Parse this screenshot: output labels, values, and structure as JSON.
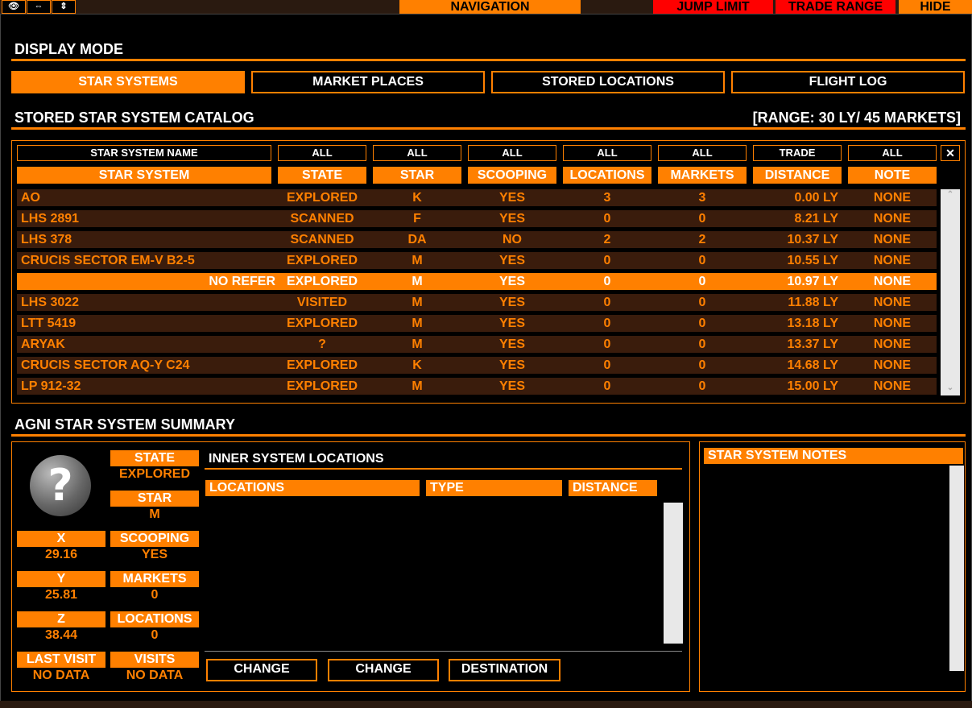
{
  "topbar": {
    "icons": [
      "eye-icon",
      "horizontal-arrows-icon",
      "vertical-arrows-icon"
    ],
    "icon_glyphs": [
      "👁",
      "⇔",
      "⇕"
    ],
    "navigation": "NAVIGATION",
    "jump_limit": "JUMP LIMIT",
    "trade_range": "TRADE RANGE",
    "hide": "HIDE"
  },
  "display_mode": {
    "title": "DISPLAY MODE",
    "buttons": [
      "STAR SYSTEMS",
      "MARKET PLACES",
      "STORED LOCATIONS",
      "FLIGHT LOG"
    ],
    "active": "STAR SYSTEMS"
  },
  "catalog": {
    "title": "STORED STAR SYSTEM CATALOG",
    "range": "[RANGE: 30 LY/ 45 MARKETS]",
    "filters": [
      "STAR SYSTEM NAME",
      "ALL",
      "ALL",
      "ALL",
      "ALL",
      "ALL",
      "TRADE",
      "ALL"
    ],
    "clear": "✕",
    "columns": [
      "STAR SYSTEM",
      "STATE",
      "STAR",
      "SCOOPING",
      "LOCATIONS",
      "MARKETS",
      "DISTANCE",
      "NOTE"
    ],
    "rows": [
      {
        "name": "AO",
        "state": "EXPLORED",
        "star": "K",
        "scooping": "YES",
        "locations": "3",
        "markets": "3",
        "distance": "0.00 LY",
        "note": "NONE"
      },
      {
        "name": "LHS 2891",
        "state": "SCANNED",
        "star": "F",
        "scooping": "YES",
        "locations": "0",
        "markets": "0",
        "distance": "8.21 LY",
        "note": "NONE"
      },
      {
        "name": "LHS 378",
        "state": "SCANNED",
        "star": "DA",
        "scooping": "NO",
        "locations": "2",
        "markets": "2",
        "distance": "10.37 LY",
        "note": "NONE"
      },
      {
        "name": "CRUCIS SECTOR EM-V B2-5",
        "state": "EXPLORED",
        "star": "M",
        "scooping": "YES",
        "locations": "0",
        "markets": "0",
        "distance": "10.55 LY",
        "note": "NONE"
      },
      {
        "name": "NO REFER",
        "state": "EXPLORED",
        "star": "M",
        "scooping": "YES",
        "locations": "0",
        "markets": "0",
        "distance": "10.97 LY",
        "note": "NONE",
        "selected": true
      },
      {
        "name": "LHS 3022",
        "state": "VISITED",
        "star": "M",
        "scooping": "YES",
        "locations": "0",
        "markets": "0",
        "distance": "11.88 LY",
        "note": "NONE"
      },
      {
        "name": "LTT 5419",
        "state": "EXPLORED",
        "star": "M",
        "scooping": "YES",
        "locations": "0",
        "markets": "0",
        "distance": "13.18 LY",
        "note": "NONE"
      },
      {
        "name": "ARYAK",
        "state": "?",
        "star": "M",
        "scooping": "YES",
        "locations": "0",
        "markets": "0",
        "distance": "13.37 LY",
        "note": "NONE"
      },
      {
        "name": "CRUCIS SECTOR AQ-Y C24",
        "state": "EXPLORED",
        "star": "K",
        "scooping": "YES",
        "locations": "0",
        "markets": "0",
        "distance": "14.68 LY",
        "note": "NONE"
      },
      {
        "name": "LP 912-32",
        "state": "EXPLORED",
        "star": "M",
        "scooping": "YES",
        "locations": "0",
        "markets": "0",
        "distance": "15.00 LY",
        "note": "NONE"
      }
    ]
  },
  "summary": {
    "title": "AGNI STAR SYSTEM SUMMARY",
    "state_label": "STATE",
    "state": "EXPLORED",
    "star_label": "STAR",
    "star": "M",
    "x_label": "X",
    "x": "29.16",
    "scooping_label": "SCOOPING",
    "scooping": "YES",
    "y_label": "Y",
    "y": "25.81",
    "markets_label": "MARKETS",
    "markets": "0",
    "z_label": "Z",
    "z": "38.44",
    "locations_label": "LOCATIONS",
    "locations": "0",
    "last_visit_label": "LAST VISIT",
    "last_visit": "NO DATA",
    "visits_label": "VISITS",
    "visits": "NO DATA",
    "inner_title": "INNER SYSTEM LOCATIONS",
    "inner_columns": [
      "LOCATIONS",
      "TYPE",
      "DISTANCE"
    ],
    "buttons": [
      "CHANGE",
      "CHANGE",
      "DESTINATION"
    ],
    "notes_title": "STAR SYSTEM NOTES"
  },
  "colors": {
    "accent": "#ff8000",
    "row_bg": "#3a1c0c",
    "red": "#ff0000",
    "background": "#000000"
  }
}
